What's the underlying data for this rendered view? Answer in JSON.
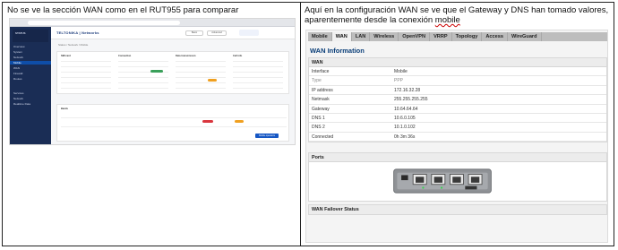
{
  "left": {
    "caption": "No se ve la sección WAN como en el RUT955 para comparar",
    "screenshot": {
      "brand": "TELTONIKA | Networks",
      "top_buttons": [
        "Basic",
        "Advanced"
      ],
      "sidebar_header": "STATUS",
      "sidebar_items": [
        {
          "label": "Overview",
          "active": false
        },
        {
          "label": "System",
          "active": false
        },
        {
          "label": "Network",
          "active": false
        },
        {
          "label": "Mobile",
          "active": true
        },
        {
          "label": "WAN",
          "active": false
        },
        {
          "label": "Firewall",
          "active": false
        },
        {
          "label": "Routes",
          "active": false
        },
        {
          "label": "Services",
          "active": false
        },
        {
          "label": "Network",
          "active": false
        },
        {
          "label": "Realtime Data",
          "active": false
        }
      ],
      "breadcrumb": "Status / Network / Mobile",
      "section_titles": [
        "SIM card",
        "Connection",
        "Data transmission",
        "Cell info"
      ],
      "bands_title": "Bands",
      "action_button": "Mobile operators"
    }
  },
  "right": {
    "caption": "Aquí en la configuración WAN se ve que el Gateway y DNS han tomado valores, aparentemente desde la conexión mobile",
    "caption_underlined": "mobile",
    "tabs": [
      "Mobile",
      "WAN",
      "LAN",
      "Wireless",
      "OpenVPN",
      "VRRP",
      "Topology",
      "Access",
      "WireGuard"
    ],
    "active_tab": "WAN",
    "section_title": "WAN Information",
    "panel_title": "WAN",
    "rows": [
      {
        "key": "Interface",
        "value": "Mobile"
      },
      {
        "key": "Type",
        "value": "PPP"
      },
      {
        "key": "IP address",
        "value": "172.16.32.28"
      },
      {
        "key": "Netmask",
        "value": "255.255.255.255"
      },
      {
        "key": "Gateway",
        "value": "10.64.64.64"
      },
      {
        "key": "DNS 1",
        "value": "10.6.0.105"
      },
      {
        "key": "DNS 2",
        "value": "10.1.0.102"
      },
      {
        "key": "Connected",
        "value": "0h 3m 36s"
      }
    ],
    "ports_title": "Ports",
    "failover_title": "WAN Failover Status"
  }
}
